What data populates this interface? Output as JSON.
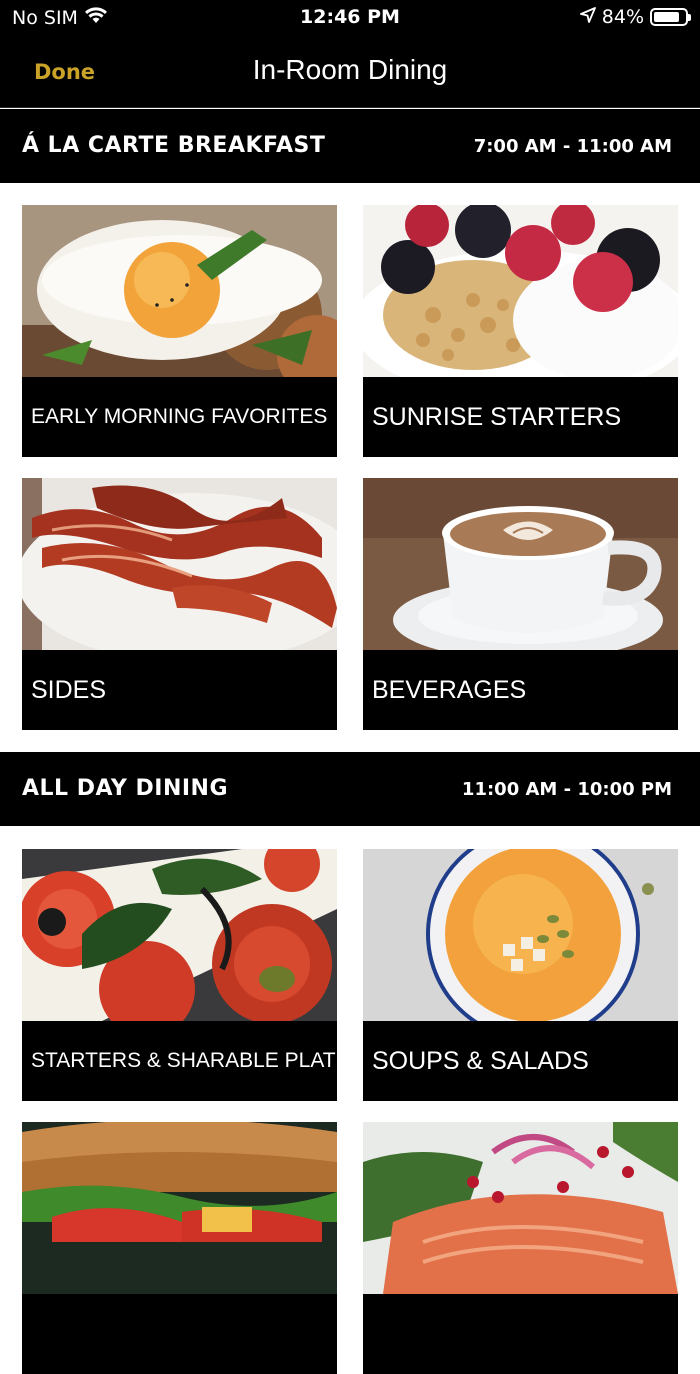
{
  "status_bar": {
    "carrier": "No SIM",
    "time": "12:46 PM",
    "battery": "84%",
    "battery_level": 0.84
  },
  "nav": {
    "done_label": "Done",
    "title": "In-Room Dining"
  },
  "sections": [
    {
      "title": "Á LA CARTE BREAKFAST",
      "hours": "7:00 AM - 11:00 AM",
      "items": [
        {
          "label": "EARLY MORNING FAVORITES",
          "icon": "fried-egg-image"
        },
        {
          "label": "SUNRISE STARTERS",
          "icon": "yogurt-granola-image"
        },
        {
          "label": "SIDES",
          "icon": "bacon-image"
        },
        {
          "label": "BEVERAGES",
          "icon": "coffee-cup-image"
        }
      ]
    },
    {
      "title": "ALL DAY DINING",
      "hours": "11:00 AM - 10:00 PM",
      "items": [
        {
          "label": "STARTERS & SHARABLE PLATES",
          "icon": "caprese-image"
        },
        {
          "label": "SOUPS & SALADS",
          "icon": "soup-bowl-image"
        },
        {
          "label": "",
          "icon": "sandwich-image"
        },
        {
          "label": "",
          "icon": "salmon-image"
        }
      ]
    }
  ],
  "colors": {
    "accent": "#c9a227",
    "bar_background": "#000000",
    "page_background": "#ffffff"
  }
}
